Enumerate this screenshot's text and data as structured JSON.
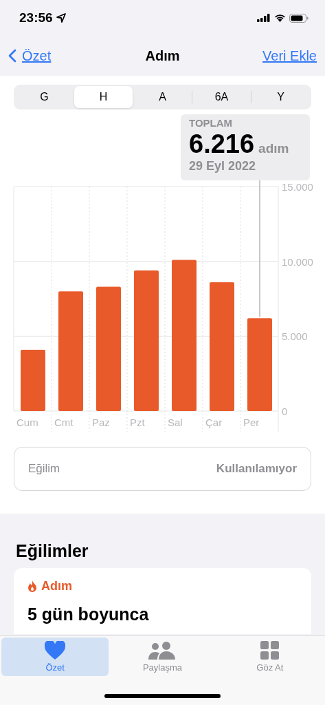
{
  "status_bar": {
    "time": "23:56"
  },
  "nav": {
    "back": "Özet",
    "title": "Adım",
    "action": "Veri Ekle"
  },
  "ranges": [
    {
      "label": "G",
      "selected": false
    },
    {
      "label": "H",
      "selected": true
    },
    {
      "label": "A",
      "selected": false
    },
    {
      "label": "6A",
      "selected": false
    },
    {
      "label": "Y",
      "selected": false
    }
  ],
  "summary": {
    "label": "TOPLAM",
    "value": "6.216",
    "unit": "adım",
    "date": "29 Eyl 2022"
  },
  "chart_data": {
    "type": "bar",
    "categories": [
      "Cum",
      "Cmt",
      "Paz",
      "Pzt",
      "Sal",
      "Çar",
      "Per"
    ],
    "values": [
      4100,
      8000,
      8300,
      9400,
      10100,
      8600,
      6200
    ],
    "ylim": [
      0,
      15000
    ],
    "yticks": [
      {
        "value": 0,
        "label": "0"
      },
      {
        "value": 5000,
        "label": "5.000"
      },
      {
        "value": 10000,
        "label": "10.000"
      },
      {
        "value": 15000,
        "label": "15.000"
      }
    ]
  },
  "trend_row": {
    "label": "Eğilim",
    "value": "Kullanılamıyor"
  },
  "trends": {
    "heading": "Eğilimler",
    "card": {
      "category": "Adım",
      "title": "5 gün boyunca"
    }
  },
  "tab_bar": [
    {
      "label": "Özet",
      "selected": true
    },
    {
      "label": "Paylaşma",
      "selected": false
    },
    {
      "label": "Göz At",
      "selected": false
    }
  ]
}
